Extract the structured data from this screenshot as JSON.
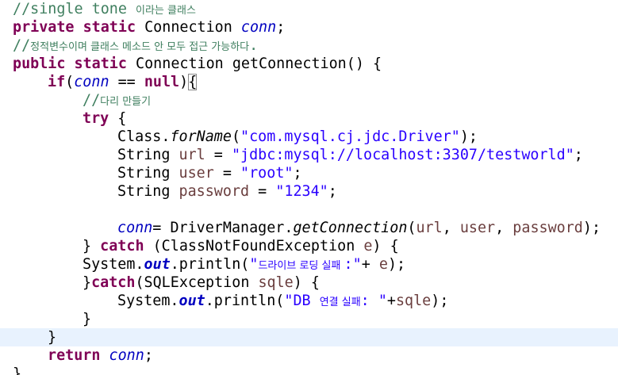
{
  "editor": {
    "language": "java",
    "current_line_index": 18,
    "lines": [
      {
        "indent": 0,
        "tokens": [
          {
            "t": "//single tone ",
            "c": "cm"
          },
          {
            "t": "이라는 클래스",
            "c": "cm ko"
          }
        ]
      },
      {
        "indent": 0,
        "tokens": [
          {
            "t": "private",
            "c": "kw"
          },
          {
            "t": " "
          },
          {
            "t": "static",
            "c": "kw"
          },
          {
            "t": " Connection "
          },
          {
            "t": "conn",
            "c": "fld"
          },
          {
            "t": ";"
          }
        ]
      },
      {
        "indent": 0,
        "tokens": [
          {
            "t": "//",
            "c": "cm"
          },
          {
            "t": "정적변수이며 클래스 메소드 안 모두 접근 가능하다",
            "c": "cm ko"
          },
          {
            "t": ".",
            "c": "cm"
          }
        ]
      },
      {
        "indent": 0,
        "tokens": [
          {
            "t": "public",
            "c": "kw"
          },
          {
            "t": " "
          },
          {
            "t": "static",
            "c": "kw"
          },
          {
            "t": " Connection getConnection() {"
          }
        ]
      },
      {
        "indent": 1,
        "tokens": [
          {
            "t": "if",
            "c": "kw"
          },
          {
            "t": "("
          },
          {
            "t": "conn",
            "c": "fld"
          },
          {
            "t": " == "
          },
          {
            "t": "null",
            "c": "kw"
          },
          {
            "t": ")"
          },
          {
            "t": "{",
            "c": "bracket-box"
          }
        ]
      },
      {
        "indent": 2,
        "tokens": [
          {
            "t": "//",
            "c": "cm"
          },
          {
            "t": "다리 만들기",
            "c": "cm ko"
          }
        ]
      },
      {
        "indent": 2,
        "tokens": [
          {
            "t": "try",
            "c": "kw"
          },
          {
            "t": " {"
          }
        ]
      },
      {
        "indent": 3,
        "tokens": [
          {
            "t": "Class."
          },
          {
            "t": "forName",
            "c": "smth"
          },
          {
            "t": "("
          },
          {
            "t": "\"com.mysql.cj.jdc.Driver\"",
            "c": "str"
          },
          {
            "t": ");"
          }
        ]
      },
      {
        "indent": 3,
        "tokens": [
          {
            "t": "String "
          },
          {
            "t": "url",
            "c": "loc"
          },
          {
            "t": " = "
          },
          {
            "t": "\"jdbc:mysql://localhost:3307/testworld\"",
            "c": "str"
          },
          {
            "t": ";"
          }
        ]
      },
      {
        "indent": 3,
        "tokens": [
          {
            "t": "String "
          },
          {
            "t": "user",
            "c": "loc"
          },
          {
            "t": " = "
          },
          {
            "t": "\"root\"",
            "c": "str"
          },
          {
            "t": ";"
          }
        ]
      },
      {
        "indent": 3,
        "tokens": [
          {
            "t": "String "
          },
          {
            "t": "password",
            "c": "loc"
          },
          {
            "t": " = "
          },
          {
            "t": "\"1234\"",
            "c": "str"
          },
          {
            "t": ";"
          }
        ]
      },
      {
        "indent": 0,
        "tokens": []
      },
      {
        "indent": 3,
        "tokens": [
          {
            "t": "conn",
            "c": "fld"
          },
          {
            "t": "= DriverManager."
          },
          {
            "t": "getConnection",
            "c": "smth"
          },
          {
            "t": "("
          },
          {
            "t": "url",
            "c": "loc"
          },
          {
            "t": ", "
          },
          {
            "t": "user",
            "c": "loc"
          },
          {
            "t": ", "
          },
          {
            "t": "password",
            "c": "loc"
          },
          {
            "t": ");"
          }
        ]
      },
      {
        "indent": 2,
        "tokens": [
          {
            "t": "} "
          },
          {
            "t": "catch",
            "c": "kw"
          },
          {
            "t": " (ClassNotFoundException "
          },
          {
            "t": "e",
            "c": "loc"
          },
          {
            "t": ") {"
          }
        ]
      },
      {
        "indent": 2,
        "tokens": [
          {
            "t": "System."
          },
          {
            "t": "out",
            "c": "sfld"
          },
          {
            "t": ".println("
          },
          {
            "t": "\"",
            "c": "str"
          },
          {
            "t": "드라이브 로딩 실패 ",
            "c": "str ko"
          },
          {
            "t": ":\"",
            "c": "str"
          },
          {
            "t": "+ "
          },
          {
            "t": "e",
            "c": "loc"
          },
          {
            "t": ");"
          }
        ]
      },
      {
        "indent": 2,
        "tokens": [
          {
            "t": "}"
          },
          {
            "t": "catch",
            "c": "kw"
          },
          {
            "t": "(SQLException "
          },
          {
            "t": "sqle",
            "c": "loc"
          },
          {
            "t": ") {"
          }
        ]
      },
      {
        "indent": 3,
        "tokens": [
          {
            "t": "System."
          },
          {
            "t": "out",
            "c": "sfld"
          },
          {
            "t": ".println("
          },
          {
            "t": "\"DB ",
            "c": "str"
          },
          {
            "t": "연결 실패",
            "c": "str ko"
          },
          {
            "t": ": \"",
            "c": "str"
          },
          {
            "t": "+"
          },
          {
            "t": "sqle",
            "c": "loc"
          },
          {
            "t": ");"
          }
        ]
      },
      {
        "indent": 2,
        "tokens": [
          {
            "t": "}"
          }
        ]
      },
      {
        "indent": 1,
        "tokens": [
          {
            "t": "}"
          }
        ]
      },
      {
        "indent": 1,
        "tokens": [
          {
            "t": "return",
            "c": "kw"
          },
          {
            "t": " "
          },
          {
            "t": "conn",
            "c": "fld"
          },
          {
            "t": ";"
          }
        ]
      },
      {
        "indent": 0,
        "tokens": [
          {
            "t": "}"
          }
        ]
      }
    ]
  }
}
